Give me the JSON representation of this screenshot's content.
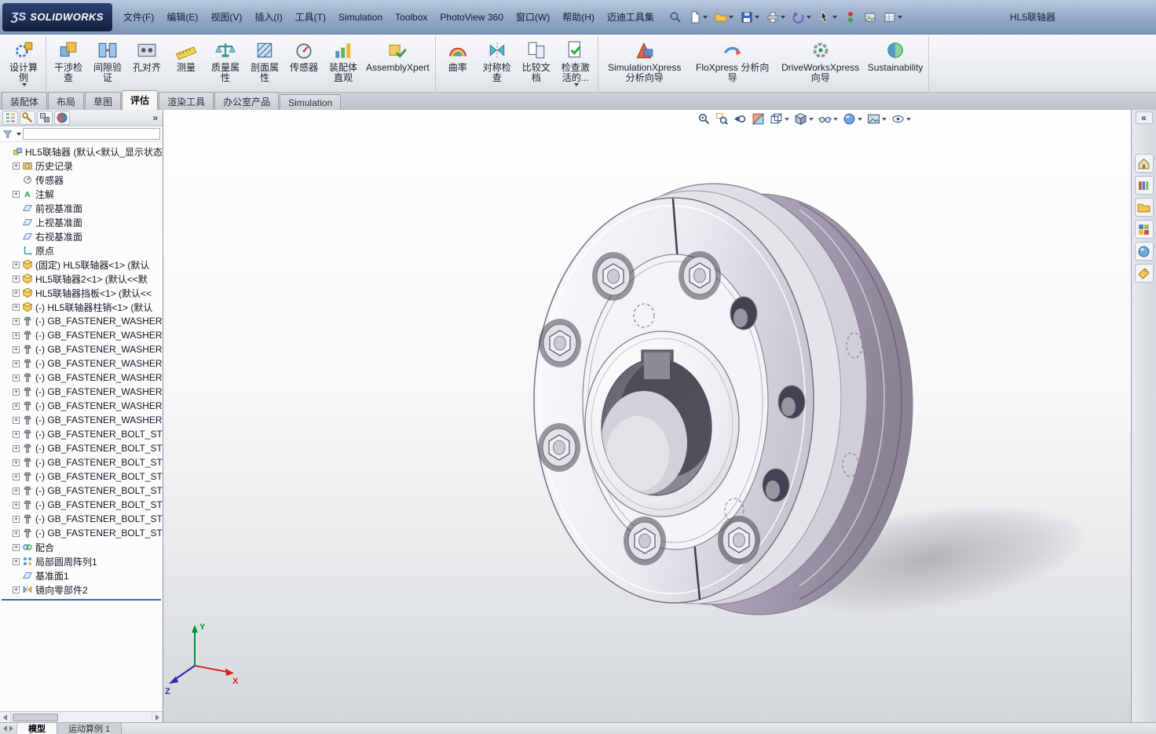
{
  "titlebar": {
    "logo_mark": "ƷS",
    "logo_text": "SOLIDWORKS",
    "menus": [
      "文件(F)",
      "编辑(E)",
      "视图(V)",
      "插入(I)",
      "工具(T)",
      "Simulation",
      "Toolbox",
      "PhotoView 360",
      "窗口(W)",
      "帮助(H)",
      "迈迪工具集"
    ],
    "doc_title": "HL5联轴器",
    "quickbar": [
      {
        "icon": "sym-magnifier",
        "name": "search"
      },
      {
        "icon": "sym-page",
        "name": "new-document",
        "caret": true
      },
      {
        "icon": "sym-folder",
        "name": "open-document",
        "caret": true
      },
      {
        "icon": "sym-floppy",
        "name": "save",
        "caret": true
      },
      {
        "icon": "sym-printer",
        "name": "print",
        "caret": true
      },
      {
        "icon": "sym-undo",
        "name": "undo",
        "caret": true
      },
      {
        "icon": "sym-cursor",
        "name": "select",
        "caret": true
      },
      {
        "icon": "sym-rebuild",
        "name": "rebuild"
      },
      {
        "icon": "sym-image",
        "name": "edit-color"
      },
      {
        "icon": "sym-grid",
        "name": "options",
        "caret": true
      }
    ]
  },
  "ribbon": {
    "groups": [
      [
        {
          "label": "设计算例",
          "icon": "rb-design-study",
          "caret": true
        }
      ],
      [
        {
          "label": "干涉检查",
          "icon": "rb-interference"
        },
        {
          "label": "间隙验证",
          "icon": "rb-clearance"
        },
        {
          "label": "孔对齐",
          "icon": "rb-hole-align"
        },
        {
          "label": "测量",
          "icon": "rb-measure"
        },
        {
          "label": "质量属性",
          "icon": "rb-mass"
        },
        {
          "label": "剖面属性",
          "icon": "rb-section"
        },
        {
          "label": "传感器",
          "icon": "rb-sensor"
        },
        {
          "label": "装配体直观",
          "icon": "rb-assembly-vis"
        },
        {
          "label": "AssemblyXpert",
          "icon": "rb-xpert"
        }
      ],
      [
        {
          "label": "曲率",
          "icon": "rb-curvature"
        },
        {
          "label": "对称检查",
          "icon": "rb-symmetry"
        },
        {
          "label": "比较文档",
          "icon": "rb-compare"
        },
        {
          "label": "检查激活的...",
          "icon": "rb-check-active",
          "caret": true
        }
      ],
      [
        {
          "label": "SimulationXpress 分析向导",
          "icon": "rb-simx"
        },
        {
          "label": "FloXpress 分析向导",
          "icon": "rb-flox"
        },
        {
          "label": "DriveWorksXpress 向导",
          "icon": "rb-dwx"
        },
        {
          "label": "Sustainability",
          "icon": "rb-sustain"
        }
      ]
    ]
  },
  "command_tabs": {
    "items": [
      "装配体",
      "布局",
      "草图",
      "评估",
      "渲染工具",
      "办公室产品",
      "Simulation"
    ],
    "active": 3
  },
  "feature_panel": {
    "header_icons": [
      "fp-tree",
      "fp-property",
      "fp-config",
      "fp-display"
    ],
    "overflow": "»",
    "filter": {
      "value": ""
    },
    "tree": [
      {
        "l": "HL5联轴器 (默认<默认_显示状态",
        "i": "t-assembly",
        "e": false
      },
      {
        "l": "历史记录",
        "i": "t-history",
        "e": true
      },
      {
        "l": "传感器",
        "i": "t-sensors",
        "e": false
      },
      {
        "l": "注解",
        "i": "t-annot",
        "e": true
      },
      {
        "l": "前视基准面",
        "i": "t-plane",
        "e": false
      },
      {
        "l": "上视基准面",
        "i": "t-plane",
        "e": false
      },
      {
        "l": "右视基准面",
        "i": "t-plane",
        "e": false
      },
      {
        "l": "原点",
        "i": "t-origin",
        "e": false
      },
      {
        "l": "(固定) HL5联轴器<1> (默认",
        "i": "t-part",
        "e": true
      },
      {
        "l": "HL5联轴器2<1> (默认<<默",
        "i": "t-part",
        "e": true
      },
      {
        "l": "HL5联轴器挡板<1> (默认<<",
        "i": "t-part",
        "e": true
      },
      {
        "l": "(-) HL5联轴器柱销<1> (默认",
        "i": "t-part",
        "e": true
      },
      {
        "l": "(-) GB_FASTENER_WASHER",
        "i": "t-fastener",
        "e": true
      },
      {
        "l": "(-) GB_FASTENER_WASHER",
        "i": "t-fastener",
        "e": true
      },
      {
        "l": "(-) GB_FASTENER_WASHER",
        "i": "t-fastener",
        "e": true
      },
      {
        "l": "(-) GB_FASTENER_WASHER",
        "i": "t-fastener",
        "e": true
      },
      {
        "l": "(-) GB_FASTENER_WASHER",
        "i": "t-fastener",
        "e": true
      },
      {
        "l": "(-) GB_FASTENER_WASHER",
        "i": "t-fastener",
        "e": true
      },
      {
        "l": "(-) GB_FASTENER_WASHER",
        "i": "t-fastener",
        "e": true
      },
      {
        "l": "(-) GB_FASTENER_WASHER",
        "i": "t-fastener",
        "e": true
      },
      {
        "l": "(-) GB_FASTENER_BOLT_ST",
        "i": "t-fastener",
        "e": true
      },
      {
        "l": "(-) GB_FASTENER_BOLT_ST",
        "i": "t-fastener",
        "e": true
      },
      {
        "l": "(-) GB_FASTENER_BOLT_ST",
        "i": "t-fastener",
        "e": true
      },
      {
        "l": "(-) GB_FASTENER_BOLT_ST",
        "i": "t-fastener",
        "e": true
      },
      {
        "l": "(-) GB_FASTENER_BOLT_ST",
        "i": "t-fastener",
        "e": true
      },
      {
        "l": "(-) GB_FASTENER_BOLT_ST",
        "i": "t-fastener",
        "e": true
      },
      {
        "l": "(-) GB_FASTENER_BOLT_ST",
        "i": "t-fastener",
        "e": true
      },
      {
        "l": "(-) GB_FASTENER_BOLT_ST",
        "i": "t-fastener",
        "e": true
      },
      {
        "l": "配合",
        "i": "t-mates",
        "e": true
      },
      {
        "l": "局部圆周阵列1",
        "i": "t-pattern",
        "e": true
      },
      {
        "l": "基准面1",
        "i": "t-plane",
        "e": false
      },
      {
        "l": "镜向零部件2",
        "i": "t-mirror",
        "e": true
      }
    ]
  },
  "viewport": {
    "headsup": [
      {
        "icon": "hu-zoomfit",
        "name": "zoom-to-fit"
      },
      {
        "icon": "hu-zoomarea",
        "name": "zoom-to-area"
      },
      {
        "icon": "hu-prev",
        "name": "previous-view"
      },
      {
        "icon": "hu-section",
        "name": "section-view"
      },
      {
        "icon": "hu-orient",
        "name": "view-orientation",
        "caret": true
      },
      {
        "icon": "hu-display",
        "name": "display-style",
        "caret": true
      },
      {
        "icon": "hu-hideshow",
        "name": "hide-show-items",
        "caret": true
      },
      {
        "icon": "hu-appearance",
        "name": "edit-appearance",
        "caret": true
      },
      {
        "icon": "hu-scene",
        "name": "apply-scene",
        "caret": true
      },
      {
        "icon": "hu-settings",
        "name": "view-settings",
        "caret": true
      }
    ],
    "triad": {
      "x": "X",
      "y": "Y",
      "z": "Z"
    }
  },
  "taskpane": {
    "collapse": "«",
    "icons": [
      {
        "icon": "tp-resources",
        "name": "solidworks-resources"
      },
      {
        "icon": "tp-library",
        "name": "design-library"
      },
      {
        "icon": "tp-explorer",
        "name": "file-explorer"
      },
      {
        "icon": "tp-palette",
        "name": "view-palette"
      },
      {
        "icon": "tp-appearances",
        "name": "appearances-scenes"
      },
      {
        "icon": "tp-props",
        "name": "custom-properties"
      }
    ]
  },
  "bottombar": {
    "tabs": [
      {
        "label": "模型"
      },
      {
        "label": "运动算例 1"
      }
    ],
    "active": 0
  }
}
